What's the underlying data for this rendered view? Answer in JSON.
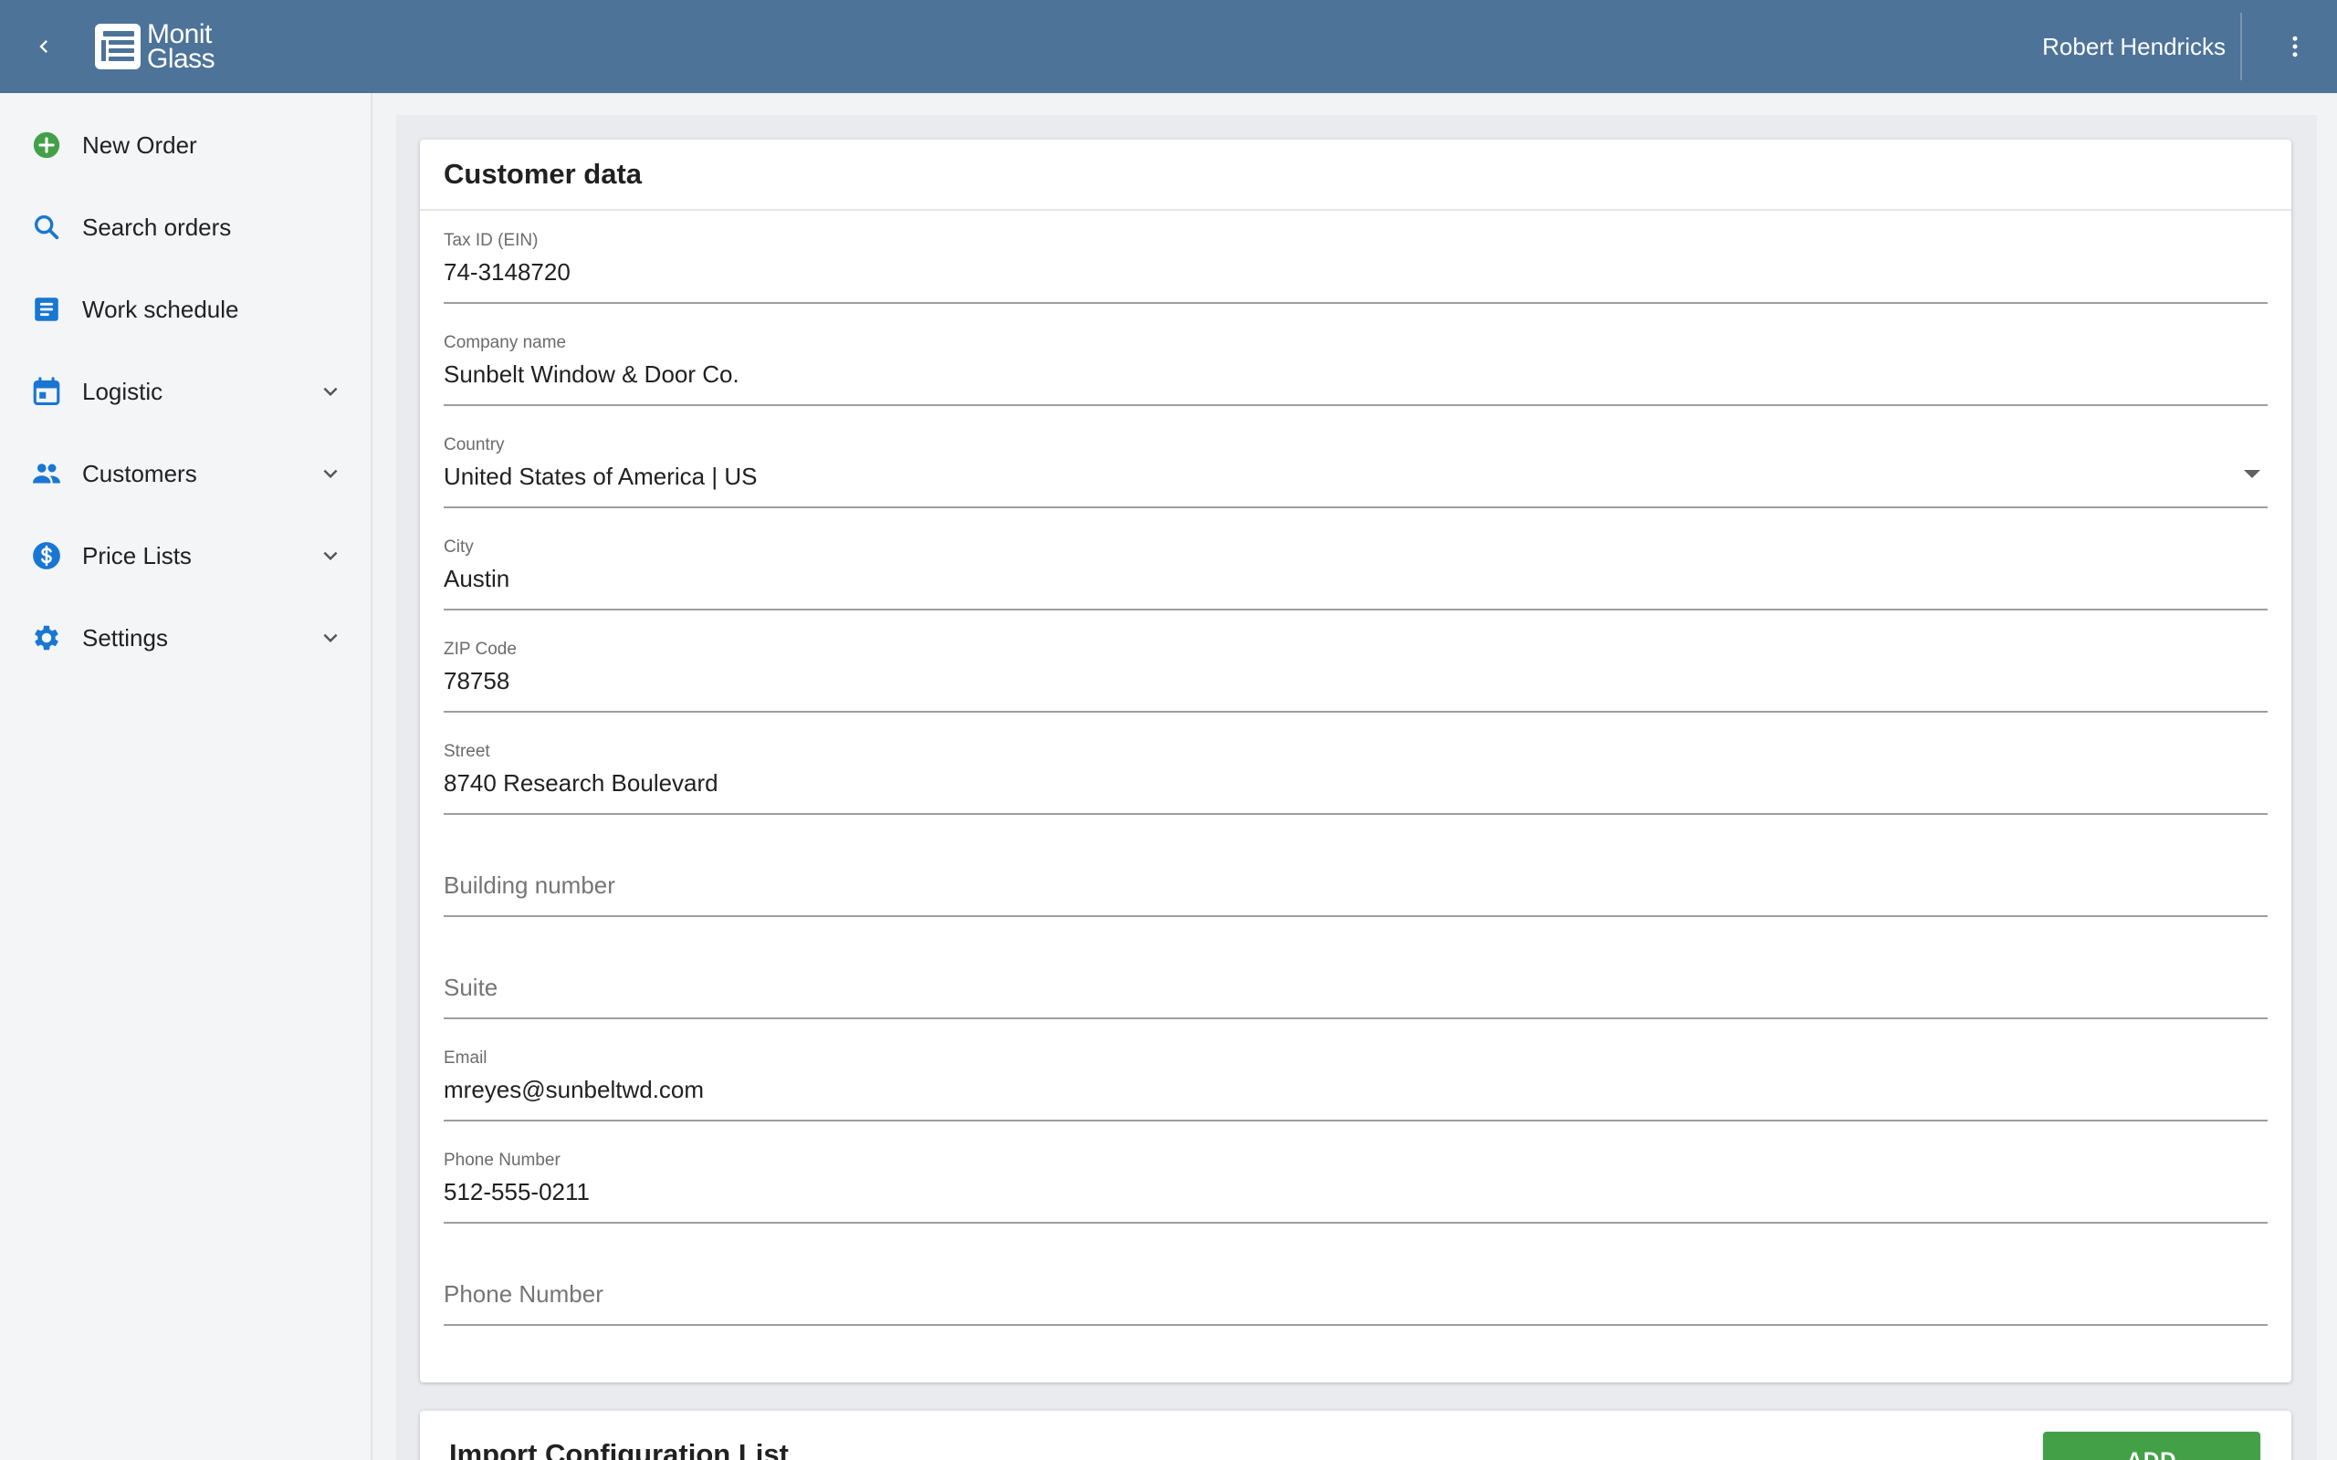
{
  "header": {
    "logo_line1": "Monit",
    "logo_line2": "Glass",
    "user_name": "Robert Hendricks"
  },
  "colors": {
    "header_bg": "#4d7399",
    "accent_blue": "#1976d2",
    "new_order_green": "#43a047",
    "add_button_green": "#43a047"
  },
  "sidebar": {
    "items": [
      {
        "label": "New Order",
        "icon": "add-circle-icon"
      },
      {
        "label": "Search orders",
        "icon": "search-icon"
      },
      {
        "label": "Work schedule",
        "icon": "schedule-icon"
      },
      {
        "label": "Logistic",
        "icon": "calendar-icon",
        "expandable": true
      },
      {
        "label": "Customers",
        "icon": "people-icon",
        "expandable": true
      },
      {
        "label": "Price Lists",
        "icon": "dollar-icon",
        "expandable": true
      },
      {
        "label": "Settings",
        "icon": "gear-icon",
        "expandable": true
      }
    ]
  },
  "customer_card": {
    "title": "Customer data",
    "fields": [
      {
        "label": "Tax ID (EIN)",
        "value": "74-3148720"
      },
      {
        "label": "Company name",
        "value": "Sunbelt Window & Door Co."
      },
      {
        "label": "Country",
        "value": "United States of America | US"
      },
      {
        "label": "City",
        "value": "Austin"
      },
      {
        "label": "ZIP Code",
        "value": "78758"
      },
      {
        "label": "Street",
        "value": "8740 Research Boulevard"
      },
      {
        "placeholder": "Building number"
      },
      {
        "placeholder": "Suite"
      },
      {
        "label": "Email",
        "value": "mreyes@sunbeltwd.com"
      },
      {
        "label": "Phone Number",
        "value": "512-555-0211"
      },
      {
        "placeholder": "Phone Number"
      }
    ]
  },
  "import_card": {
    "title": "Import Configuration List",
    "add_label": "ADD"
  }
}
